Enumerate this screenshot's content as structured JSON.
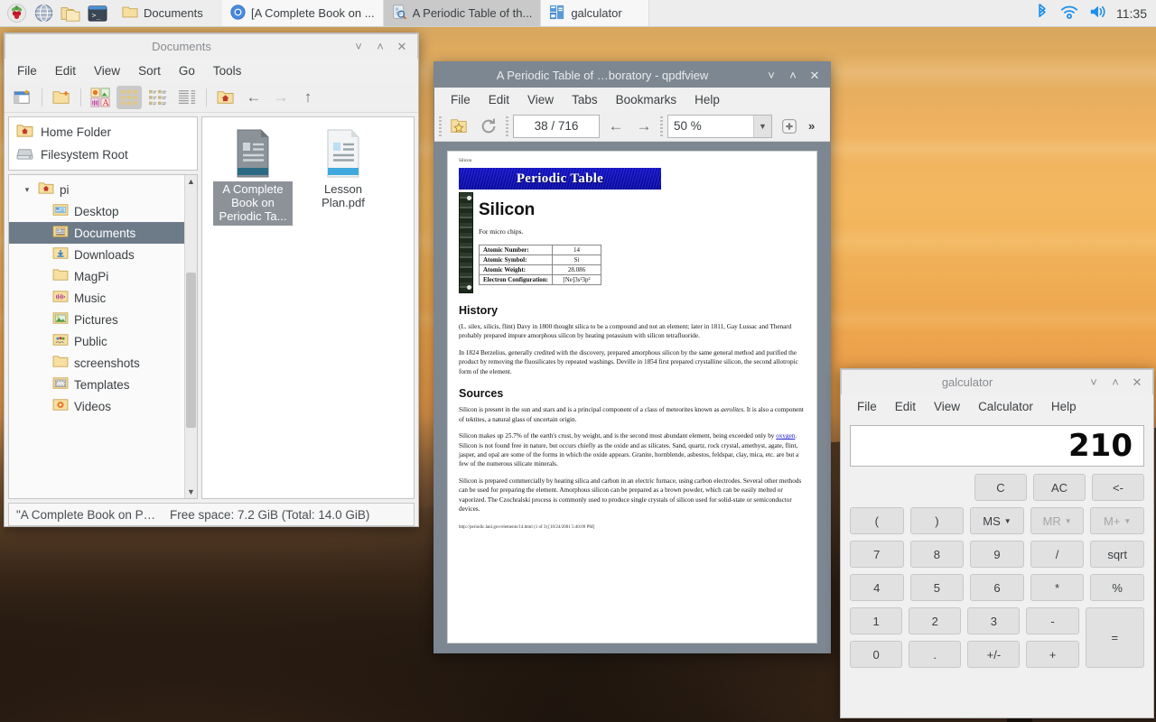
{
  "taskbar": {
    "launchers": [
      {
        "name": "raspberry-menu-icon",
        "label": "Menu"
      },
      {
        "name": "web-browser-icon",
        "label": "Web Browser"
      },
      {
        "name": "file-manager-icon",
        "label": "File Manager"
      },
      {
        "name": "terminal-icon",
        "label": "Terminal"
      }
    ],
    "tasks": [
      {
        "label": "Documents",
        "icon": "folder-icon",
        "active": false,
        "flat": true
      },
      {
        "label": "[A Complete Book on ...",
        "icon": "chromium-icon",
        "active": false,
        "flat": false
      },
      {
        "label": "A Periodic Table of th...",
        "icon": "qpdfview-icon",
        "active": true,
        "flat": false
      },
      {
        "label": "galculator",
        "icon": "galculator-icon",
        "active": false,
        "flat": false
      }
    ],
    "tray": [
      {
        "name": "bluetooth-icon",
        "color": "#1e90e8"
      },
      {
        "name": "wifi-icon",
        "color": "#1e90e8"
      },
      {
        "name": "volume-icon",
        "color": "#1e90e8"
      }
    ],
    "clock": "11:35"
  },
  "filemanager": {
    "title": "Documents",
    "window_buttons": [
      "minimize",
      "maximize",
      "close"
    ],
    "menus": [
      "File",
      "Edit",
      "View",
      "Sort",
      "Go",
      "Tools"
    ],
    "toolbar": [
      {
        "name": "new-tab-button",
        "label": "New Tab"
      },
      {
        "name": "new-folder-button",
        "label": "New Folder"
      },
      {
        "name": "icon-view-small-button",
        "label": "Thumbnail View"
      },
      {
        "name": "icon-view-button",
        "label": "Icon View",
        "selected": true
      },
      {
        "name": "compact-view-button",
        "label": "Compact View"
      },
      {
        "name": "detailed-list-view-button",
        "label": "Detailed List View"
      },
      {
        "name": "home-button",
        "label": "Home"
      },
      {
        "name": "back-button",
        "label": "Back"
      },
      {
        "name": "forward-button",
        "label": "Forward",
        "disabled": true
      },
      {
        "name": "up-button",
        "label": "Up"
      }
    ],
    "places": [
      {
        "label": "Home Folder",
        "icon": "home-folder-icon"
      },
      {
        "label": "Filesystem Root",
        "icon": "drive-icon"
      }
    ],
    "tree": [
      {
        "label": "pi",
        "icon": "home-folder-icon",
        "depth": 0,
        "twisty": true,
        "selected": false
      },
      {
        "label": "Desktop",
        "icon": "desktop-folder-icon",
        "depth": 1,
        "selected": false
      },
      {
        "label": "Documents",
        "icon": "documents-folder-icon",
        "depth": 1,
        "selected": true
      },
      {
        "label": "Downloads",
        "icon": "downloads-folder-icon",
        "depth": 1,
        "selected": false
      },
      {
        "label": "MagPi",
        "icon": "folder-icon",
        "depth": 1,
        "selected": false
      },
      {
        "label": "Music",
        "icon": "music-folder-icon",
        "depth": 1,
        "selected": false
      },
      {
        "label": "Pictures",
        "icon": "pictures-folder-icon",
        "depth": 1,
        "selected": false
      },
      {
        "label": "Public",
        "icon": "public-folder-icon",
        "depth": 1,
        "selected": false
      },
      {
        "label": "screenshots",
        "icon": "folder-icon",
        "depth": 1,
        "selected": false
      },
      {
        "label": "Templates",
        "icon": "templates-folder-icon",
        "depth": 1,
        "selected": false
      },
      {
        "label": "Videos",
        "icon": "videos-folder-icon",
        "depth": 1,
        "selected": false
      }
    ],
    "files": [
      {
        "label": "A Complete Book on Periodic Ta...",
        "icon": "pdf-document-icon",
        "selected": true
      },
      {
        "label": "Lesson Plan.pdf",
        "icon": "pdf-document-icon",
        "selected": false
      }
    ],
    "status": {
      "selection": "\"A Complete Book on Pe…",
      "freespace": "Free space: 7.2 GiB (Total: 14.0 GiB)"
    }
  },
  "pdfviewer": {
    "title": "A Periodic Table of …boratory - qpdfview",
    "menus": [
      "File",
      "Edit",
      "View",
      "Tabs",
      "Bookmarks",
      "Help"
    ],
    "toolbar": {
      "bookmark_button": "Bookmark",
      "refresh_button": "Refresh",
      "page_value": "38 / 716",
      "previous_page_button": "Previous Page",
      "next_page_button": "Next Page",
      "zoom_value": "50 %",
      "fit_button": "Fit",
      "overflow_button": "»"
    },
    "page": {
      "header": "Silicon",
      "banner": "Periodic Table",
      "element_name": "Silicon",
      "tagline": "For micro chips.",
      "properties": [
        {
          "key": "Atomic Number:",
          "value": "14"
        },
        {
          "key": "Atomic Symbol:",
          "value": "Si"
        },
        {
          "key": "Atomic Weight:",
          "value": "28.086"
        },
        {
          "key": "Electron Configuration:",
          "value": "[Ne]3s²3p²"
        }
      ],
      "history_heading": "History",
      "history_p1": "(L. silex, silicis, flint) Davy in 1800 thought silica to be a compound and not an element; later in 1811, Gay Lussac and Thenard probably prepared impure amorphous silicon by heating potassium with silicon tetrafluoride.",
      "history_p2": "In 1824 Berzelius, generally credited with the discovery, prepared amorphous silicon by the same general method and purified the product by removing the fluosilicates by repeated washings. Deville in 1854 first prepared crystalline silicon, the second allotropic form of the element.",
      "sources_heading": "Sources",
      "sources_p1_a": "Silicon is present in the sun and stars and is a principal component of a class of meteorites known as ",
      "sources_p1_i": "aerolites",
      "sources_p1_b": ". It is also a component of tektites, a natural glass of uncertain origin.",
      "sources_p2_a": "Silicon makes up 25.7% of the earth's crust, by weight, and is the second most abundant element, being exceeded only by ",
      "sources_p2_link": "oxygen",
      "sources_p2_b": ". Silicon is not found free in nature, but occurs chiefly as the oxide and as silicates. Sand, quartz, rock crystal, amethyst, agate, flint, jasper, and opal are some of the forms in which the oxide appears. Granite, hornblende, asbestos, feldspar, clay, mica, etc. are but a few of the numerous silicate minerals.",
      "sources_p3": "Silicon is prepared commercially by heating silica and carbon in an electric furnace, using carbon electrodes. Several other methods can be used for preparing the element. Amorphous silicon can be prepared as a brown powder, which can be easily melted or vaporized. The Czochralski process is commonly used to produce single crystals of silicon used for solid-state or semiconductor devices.",
      "footer": "http://periodic.lanl.gov/elements/14.html (1 of 3) [10/24/2001 5:40:09 PM]"
    }
  },
  "calculator": {
    "title": "galculator",
    "menus": [
      "File",
      "Edit",
      "View",
      "Calculator",
      "Help"
    ],
    "display": "210",
    "rows": [
      [
        {
          "label": "C",
          "name": "clear-key"
        },
        {
          "label": "AC",
          "name": "all-clear-key"
        },
        {
          "label": "<-",
          "name": "backspace-key"
        }
      ],
      [
        {
          "label": "(",
          "name": "open-paren-key"
        },
        {
          "label": ")",
          "name": "close-paren-key"
        },
        {
          "label": "MS",
          "name": "memory-store-key",
          "caret": true
        },
        {
          "label": "MR",
          "name": "memory-recall-key",
          "caret": true,
          "dim": true
        },
        {
          "label": "M+",
          "name": "memory-add-key",
          "caret": true,
          "dim": true
        }
      ],
      [
        {
          "label": "7",
          "name": "digit-7-key"
        },
        {
          "label": "8",
          "name": "digit-8-key"
        },
        {
          "label": "9",
          "name": "digit-9-key"
        },
        {
          "label": "/",
          "name": "divide-key"
        },
        {
          "label": "sqrt",
          "name": "sqrt-key"
        }
      ],
      [
        {
          "label": "4",
          "name": "digit-4-key"
        },
        {
          "label": "5",
          "name": "digit-5-key"
        },
        {
          "label": "6",
          "name": "digit-6-key"
        },
        {
          "label": "*",
          "name": "multiply-key"
        },
        {
          "label": "%",
          "name": "percent-key"
        }
      ],
      [
        {
          "label": "1",
          "name": "digit-1-key"
        },
        {
          "label": "2",
          "name": "digit-2-key"
        },
        {
          "label": "3",
          "name": "digit-3-key"
        },
        {
          "label": "-",
          "name": "subtract-key"
        }
      ],
      [
        {
          "label": "0",
          "name": "digit-0-key"
        },
        {
          "label": ".",
          "name": "decimal-point-key"
        },
        {
          "label": "+/-",
          "name": "sign-toggle-key"
        },
        {
          "label": "+",
          "name": "add-key"
        }
      ]
    ],
    "equals_label": "="
  },
  "colors": {
    "accent_blue": "#1e90e8",
    "active_titlebar": "#7d8791",
    "selection": "#6d7b88",
    "window_bg": "#f0f0f0"
  }
}
